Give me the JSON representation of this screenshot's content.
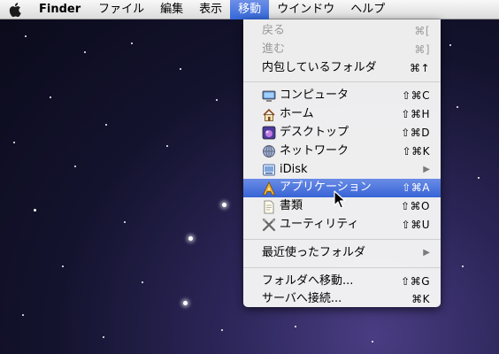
{
  "menubar": {
    "app_name": "Finder",
    "items": [
      "ファイル",
      "編集",
      "表示",
      "移動",
      "ウインドウ",
      "ヘルプ"
    ],
    "active_index": 3
  },
  "go_menu": {
    "back": {
      "label": "戻る",
      "shortcut": "⌘["
    },
    "forward": {
      "label": "進む",
      "shortcut": "⌘]"
    },
    "enclosing": {
      "label": "内包しているフォルダ",
      "shortcut": "⌘↑"
    },
    "computer": {
      "label": "コンピュータ",
      "shortcut": "⇧⌘C",
      "icon": "computer-icon"
    },
    "home": {
      "label": "ホーム",
      "shortcut": "⇧⌘H",
      "icon": "home-icon"
    },
    "desktop": {
      "label": "デスクトップ",
      "shortcut": "⇧⌘D",
      "icon": "desktop-icon"
    },
    "network": {
      "label": "ネットワーク",
      "shortcut": "⇧⌘K",
      "icon": "network-icon"
    },
    "idisk": {
      "label": "iDisk",
      "shortcut": "▶",
      "icon": "idisk-icon"
    },
    "applications": {
      "label": "アプリケーション",
      "shortcut": "⇧⌘A",
      "icon": "applications-icon"
    },
    "documents": {
      "label": "書類",
      "shortcut": "⇧⌘O",
      "icon": "documents-icon"
    },
    "utilities": {
      "label": "ユーティリティ",
      "shortcut": "⇧⌘U",
      "icon": "utilities-icon"
    },
    "recent": {
      "label": "最近使ったフォルダ",
      "shortcut": "▶"
    },
    "goto_folder": {
      "label": "フォルダへ移動...",
      "shortcut": "⇧⌘G"
    },
    "connect_server": {
      "label": "サーバへ接続...",
      "shortcut": "⌘K"
    }
  },
  "colors": {
    "highlight": "#3d6bd9",
    "menu_bg": "#f4f4f4"
  }
}
